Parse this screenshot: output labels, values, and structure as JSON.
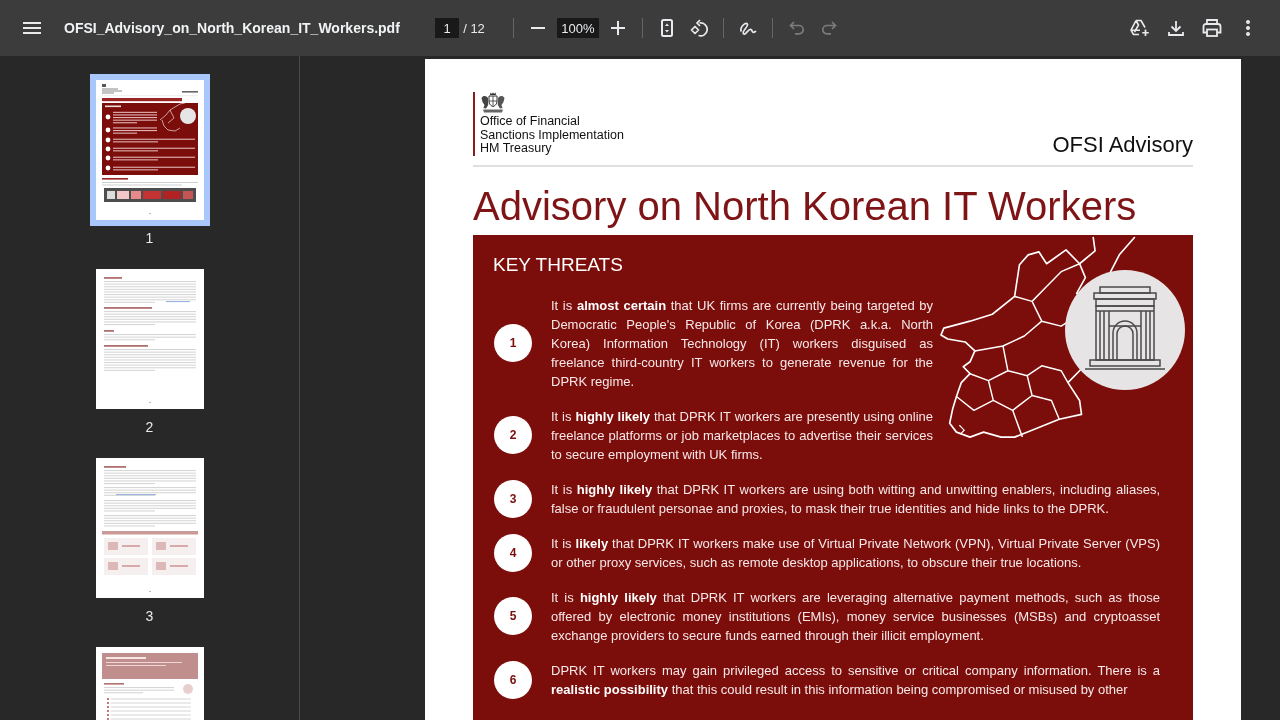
{
  "toolbar": {
    "file_name": "OFSI_Advisory_on_North_Korean_IT_Workers.pdf",
    "page_input": "1",
    "page_total": "/ 12",
    "zoom_input": "100%",
    "undo": {
      "disabled": true
    },
    "redo": {
      "disabled": true
    }
  },
  "thumbnails": [
    {
      "label": "1",
      "selected": true,
      "kind": "cover"
    },
    {
      "label": "2",
      "selected": false,
      "kind": "text"
    },
    {
      "label": "3",
      "selected": false,
      "kind": "figures"
    },
    {
      "selected": false,
      "kind": "banner"
    }
  ],
  "document": {
    "org_lines": [
      "Office of Financial",
      "Sanctions Implementation",
      "HM Treasury"
    ],
    "series": "OFSI Advisory",
    "title": "Advisory on North Korean IT Workers",
    "key_threats": {
      "heading": "KEY THREATS",
      "items": [
        {
          "number": "1",
          "text": "It is **almost certain** that UK firms are currently being targeted by Democratic People's Republic of Korea (DPRK a.k.a. North Korea) Information Technology (IT) workers disguised as freelance third-country IT workers to generate revenue for the DPRK regime."
        },
        {
          "number": "2",
          "text": "It is **highly likely** that DPRK IT workers are presently using online freelance platforms or job marketplaces to advertise their services to secure employment with UK firms."
        },
        {
          "number": "3",
          "text": "It is **highly likely** that DPRK IT workers are using both witting and unwitting enablers, including aliases, false or fraudulent personae and proxies, to mask their true identities and hide links to the DPRK."
        },
        {
          "number": "4",
          "text": "It is **likely** that DPRK IT workers make use of Virtual Private Network (VPN), Virtual Private Server (VPS) or other proxy services, such as remote desktop applications, to obscure their true locations."
        },
        {
          "number": "5",
          "text": "It is **highly likely** that DPRK IT workers are leveraging alternative payment methods, such as those offered by electronic money institutions (EMIs), money service businesses (MSBs) and cryptoasset exchange providers to secure funds earned through their illicit employment."
        },
        {
          "number": "6",
          "text": "DPRK IT workers may gain privileged access to sensitive or critical company information. There is a **realistic possibility** that this could result in this information being compromised or misused by other"
        }
      ]
    }
  }
}
